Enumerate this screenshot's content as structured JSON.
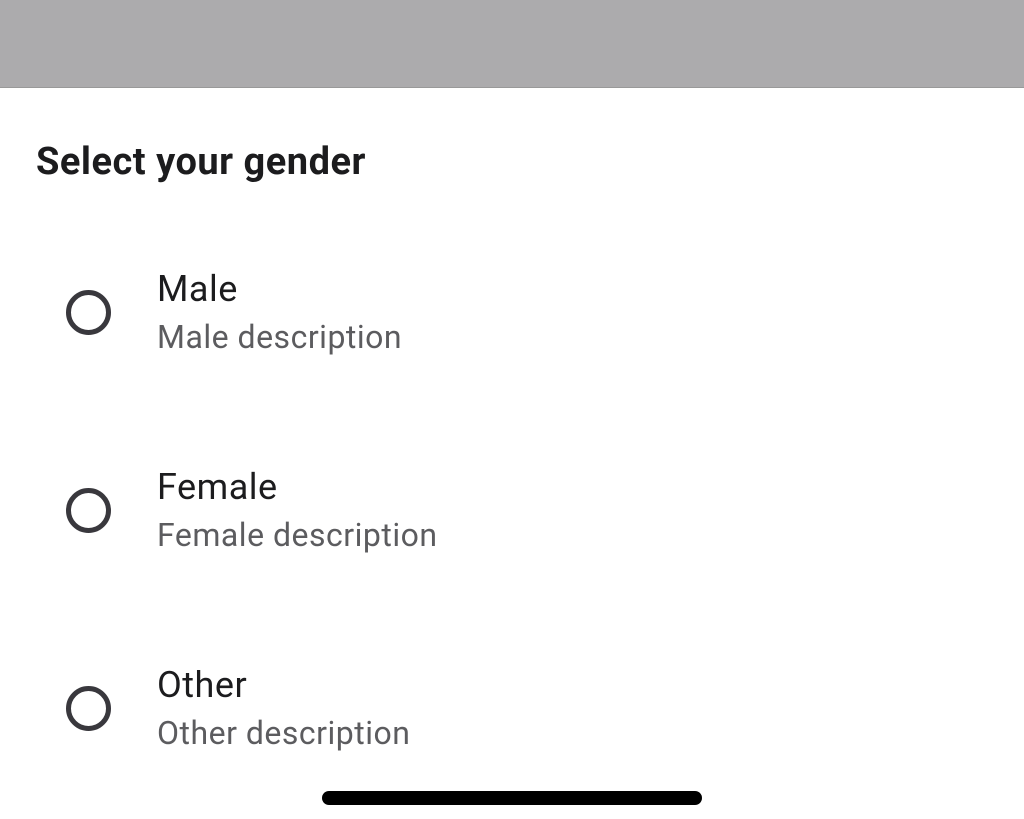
{
  "header": {
    "title": "Select your gender"
  },
  "options": [
    {
      "label": "Male",
      "description": "Male description"
    },
    {
      "label": "Female",
      "description": "Female description"
    },
    {
      "label": "Other",
      "description": "Other description"
    }
  ]
}
